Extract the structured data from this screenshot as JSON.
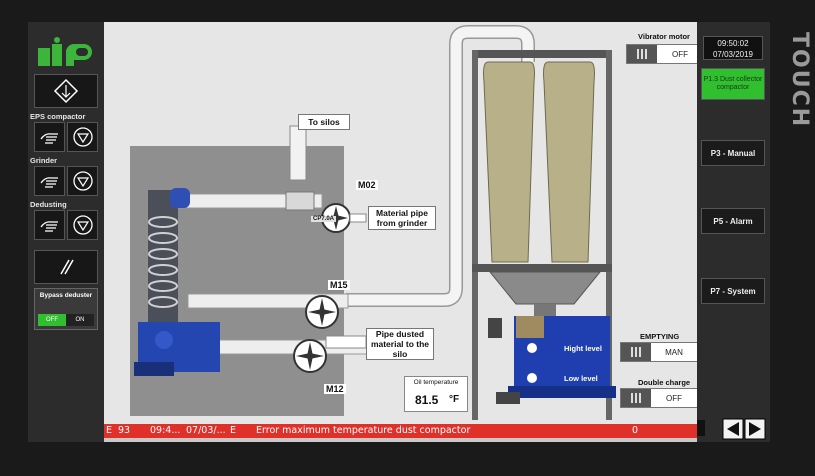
{
  "bezel": {
    "touch_label": "TOUCH"
  },
  "left_panel": {
    "logo_icon": "nip-logo",
    "sections": [
      {
        "label": "EPS compactor"
      },
      {
        "label": "Grinder"
      },
      {
        "label": "Dedusting"
      }
    ],
    "bypass": {
      "label": "Bypass deduster",
      "off_label": "OFF",
      "on_label": "ON",
      "state": "OFF"
    }
  },
  "main": {
    "to_silos": "To silos",
    "material_pipe": "Material pipe from grinder",
    "pipe_dusted": "Pipe dusted material to the silo",
    "motors": {
      "m02": "M02",
      "m15": "M15",
      "m12": "M12"
    },
    "cp_label": "CP7.0A",
    "oil_temperature": {
      "label": "Oil temperature",
      "value": "81.5",
      "unit": "°F"
    },
    "levels": {
      "high": "Hight level",
      "low": "Low level"
    },
    "vibrator_motor": {
      "label": "Vibrator motor",
      "state": "OFF"
    },
    "emptying": {
      "label": "EMPTYING",
      "state": "MAN"
    },
    "double_charge": {
      "label": "Double charge",
      "state": "OFF"
    }
  },
  "right_panel": {
    "time": "09:50:02",
    "date": "07/03/2019",
    "nav": [
      {
        "label": "P1.3 Dust collector compactor",
        "active": true
      },
      {
        "label": "P3 - Manual"
      },
      {
        "label": "P5 - Alarm"
      },
      {
        "label": "P7 - System"
      }
    ]
  },
  "alarm": {
    "type": "E",
    "code": "93",
    "time": "09:4...",
    "date": "07/03/...",
    "state": "E",
    "message": "Error maximum temperature dust compactor",
    "count": "0"
  },
  "colors": {
    "alarm_bar": "#e0302a",
    "active_nav": "#2fbf2f",
    "silo_blue": "#1f3fb0",
    "filter_tube": "#b7b089"
  }
}
